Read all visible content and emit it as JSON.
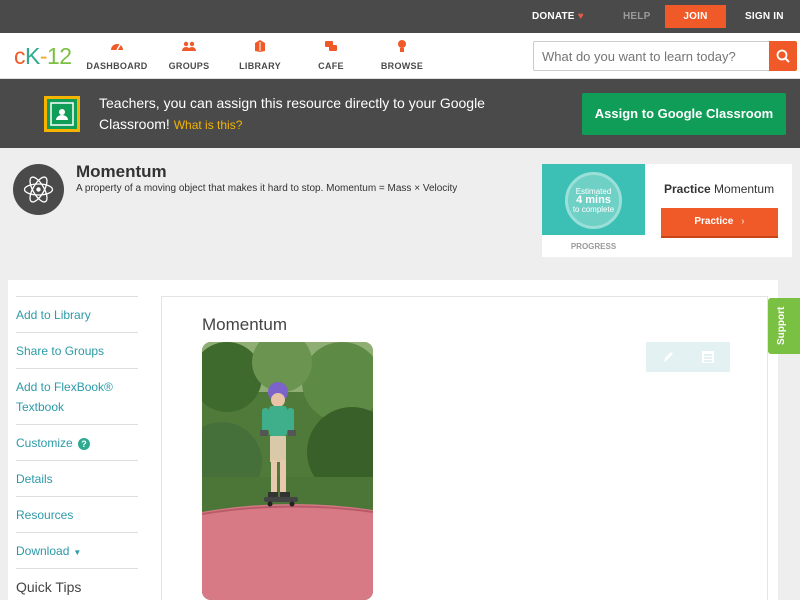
{
  "topbar": {
    "donate": "DONATE",
    "help": "HELP",
    "join": "JOIN",
    "sign_in": "SIGN IN"
  },
  "nav": {
    "logo": {
      "c": "c",
      "k": "K",
      "dash": "-",
      "num": "12"
    },
    "items": [
      {
        "label": "DASHBOARD",
        "icon": "dashboard-icon"
      },
      {
        "label": "GROUPS",
        "icon": "groups-icon"
      },
      {
        "label": "LIBRARY",
        "icon": "library-icon"
      },
      {
        "label": "CAFE",
        "icon": "cafe-icon"
      },
      {
        "label": "BROWSE",
        "icon": "browse-icon"
      }
    ],
    "search_placeholder": "What do you want to learn today?"
  },
  "classroom_banner": {
    "text": "Teachers, you can assign this resource directly to your Google Classroom!",
    "what_link": "What is this?",
    "assign_button": "Assign to Google Classroom"
  },
  "concept": {
    "title": "Momentum",
    "description": "A property of a moving object that makes it hard to stop. Momentum = Mass × Velocity"
  },
  "practice": {
    "estimated_line1": "Estimated",
    "estimated_line2": "4 mins",
    "estimated_line3": "to complete",
    "progress_label": "PROGRESS",
    "heading_bold": "Practice",
    "heading_rest": "Momentum",
    "button": "Practice"
  },
  "sidebar": {
    "items": [
      {
        "label": "Add to Library"
      },
      {
        "label": "Share to Groups"
      },
      {
        "label": "Add to FlexBook®"
      },
      {
        "label": "Textbook"
      },
      {
        "label": "Customize"
      },
      {
        "label": "Details"
      },
      {
        "label": "Resources"
      },
      {
        "label": "Download"
      },
      {
        "label": "Quick Tips"
      }
    ]
  },
  "content": {
    "title": "Momentum"
  },
  "support": "Support",
  "colors": {
    "brand_orange": "#f05a28",
    "classroom_green": "#0f9d58",
    "dark_bar": "#4a4a4a",
    "link_teal": "#2c9aa8",
    "support_green": "#7ac143"
  }
}
